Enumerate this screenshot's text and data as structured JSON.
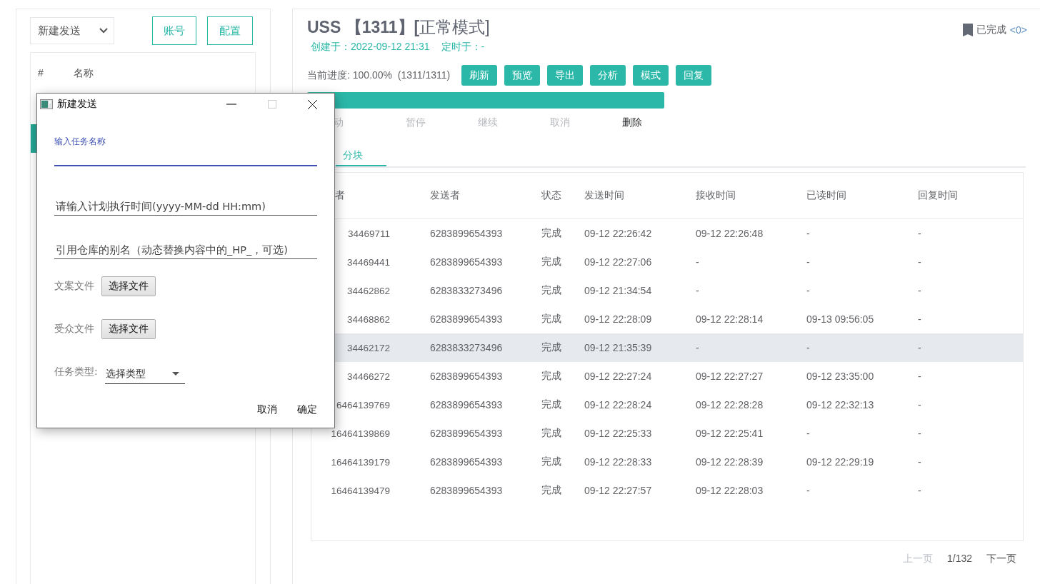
{
  "sidebar": {
    "select": {
      "value": "新建发送"
    },
    "buttons": [
      "账号",
      "配置"
    ],
    "table": {
      "columns": [
        "#",
        "名称"
      ],
      "rows": [
        {
          "selected": true
        }
      ]
    }
  },
  "task": {
    "title": "**USS 【1311】[**正常模式]",
    "created": "创建于：2022-09-12 21:31",
    "scheduled": "定时于：-",
    "done_label": "已完成",
    "done_count": "<0>",
    "progress_text": "当前进度: 100.00%  (1311/1311)",
    "buttons": [
      "刷新",
      "预览",
      "导出",
      "分析",
      "模式",
      "回复"
    ],
    "progress": {
      "level": 1.0
    },
    "actions": [
      {
        "label": "动",
        "disabled": true
      },
      {
        "label": "暂停",
        "disabled": true
      },
      {
        "label": "继续",
        "disabled": true
      },
      {
        "label": "取消",
        "disabled": true
      },
      {
        "label": "删除",
        "disabled": false
      }
    ],
    "tabs": [
      {
        "label": "分块",
        "selected": true
      }
    ]
  },
  "table": {
    "columns": [
      "者",
      "发送者",
      "状态",
      "发送时间",
      "接收时间",
      "已读时间",
      "回复时间"
    ],
    "rows": [
      {
        "selected": false,
        "cells": [
          "34469711",
          "6283899654393",
          "完成",
          "09-12 22:26:42",
          "09-12 22:26:48",
          "-",
          "-"
        ]
      },
      {
        "selected": false,
        "cells": [
          "34469441",
          "6283899654393",
          "完成",
          "09-12 22:27:06",
          "-",
          "-",
          "-"
        ]
      },
      {
        "selected": false,
        "cells": [
          "34462862",
          "6283833273496",
          "完成",
          "09-12 21:34:54",
          "-",
          "-",
          "-"
        ]
      },
      {
        "selected": false,
        "cells": [
          "34468862",
          "6283899654393",
          "完成",
          "09-12 22:28:09",
          "09-12 22:28:14",
          "09-13 09:56:05",
          "-"
        ]
      },
      {
        "selected": true,
        "cells": [
          "34462172",
          "6283833273496",
          "完成",
          "09-12 21:35:39",
          "-",
          "-",
          "-"
        ]
      },
      {
        "selected": false,
        "cells": [
          "34466272",
          "6283899654393",
          "完成",
          "09-12 22:27:24",
          "09-12 22:27:27",
          "09-12 23:35:00",
          "-"
        ]
      },
      {
        "selected": false,
        "cells": [
          "6464139769",
          "6283899654393",
          "完成",
          "09-12 22:28:24",
          "09-12 22:28:28",
          "09-12 22:32:13",
          "-"
        ]
      },
      {
        "selected": false,
        "cells": [
          "16464139869",
          "6283899654393",
          "完成",
          "09-12 22:25:33",
          "09-12 22:25:41",
          "-",
          "-"
        ]
      },
      {
        "selected": false,
        "cells": [
          "16464139179",
          "6283899654393",
          "完成",
          "09-12 22:28:33",
          "09-12 22:28:39",
          "09-12 22:29:19",
          "-"
        ]
      },
      {
        "selected": false,
        "cells": [
          "16464139479",
          "6283899654393",
          "完成",
          "09-12 22:27:57",
          "09-12 22:28:03",
          "-",
          "-"
        ]
      }
    ]
  },
  "pagination": {
    "prev": {
      "label": "上一页",
      "disabled": true
    },
    "page": "1/132",
    "next": {
      "label": "下一页",
      "disabled": false
    }
  },
  "dialog": {
    "title": "新建发送",
    "maximize_disabled": true,
    "fields": [
      {
        "kind": "floating",
        "label": "输入任务名称",
        "focused": true
      },
      {
        "kind": "text",
        "placeholder": "请输入计划执行时间(yyyy-MM-dd HH:mm)",
        "focused": false
      },
      {
        "kind": "text",
        "placeholder": "引用仓库的别名（动态替换内容中的_HP_，可选)",
        "focused": false
      }
    ],
    "files": [
      {
        "label": "文案文件",
        "button": "选择文件"
      },
      {
        "label": "受众文件",
        "button": "选择文件"
      }
    ],
    "type": {
      "label": "任务类型:",
      "value": "选择类型"
    },
    "buttons": [
      "取消",
      "确定"
    ]
  }
}
